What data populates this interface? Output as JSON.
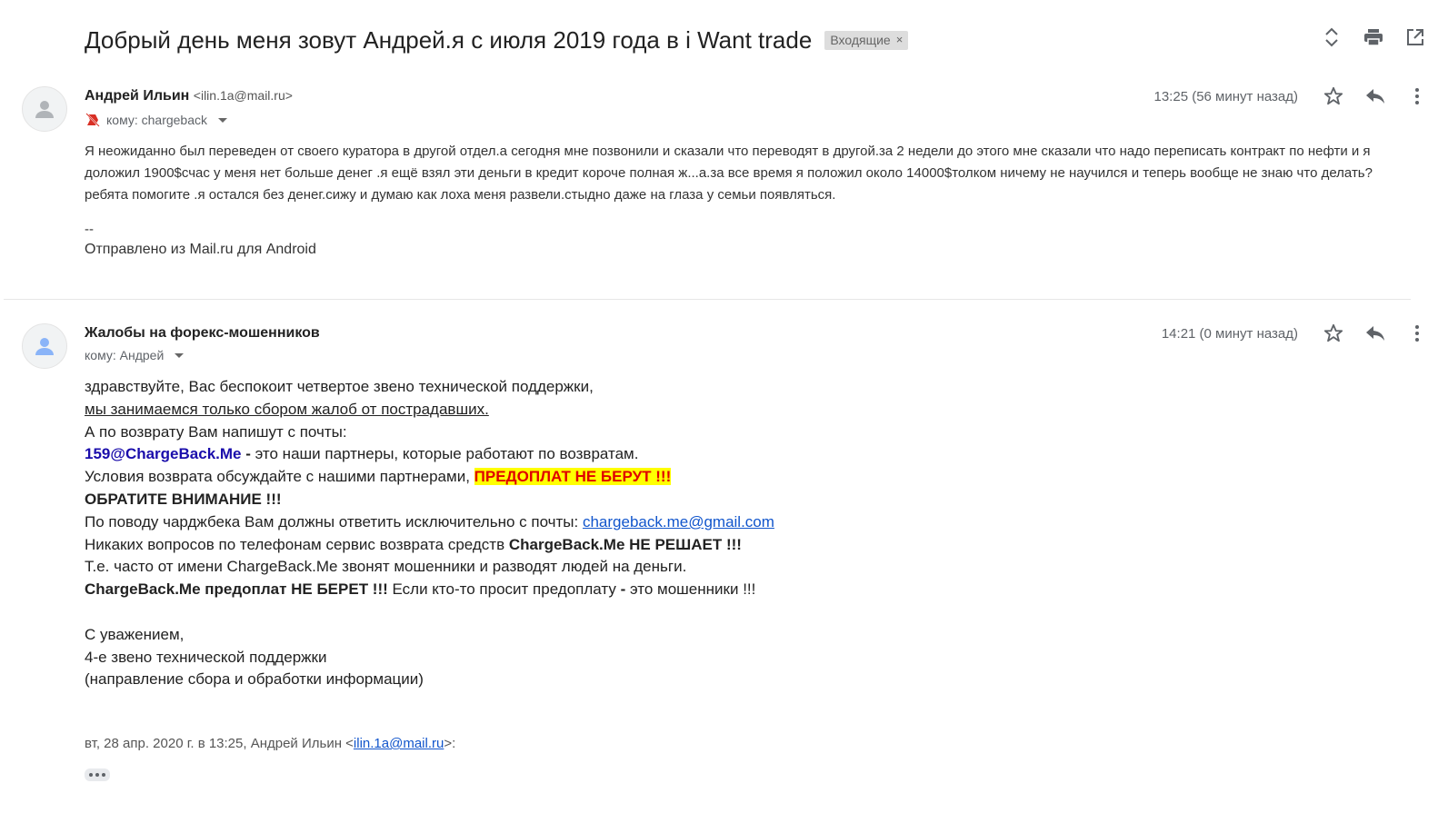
{
  "thread": {
    "subject": "Добрый день меня зовут Андрей.я с июля 2019 года в i Want trade",
    "label": "Входящие",
    "label_remove": "×",
    "icons": [
      "expand-collapse-icon",
      "print-icon",
      "open-in-new-window-icon"
    ]
  },
  "message1": {
    "sender_name": "Андрей Ильин",
    "sender_email": "<ilin.1a@mail.ru>",
    "recipient": "кому: chargeback",
    "time": "13:25 (56 минут назад)",
    "body": "Я неожиданно был переведен от своего куратора в другой отдел.а сегодня мне позвонили и сказали что переводят в другой.за 2 недели до этого мне сказали что надо переписать контракт по нефти и я доложил 1900$счас у меня нет больше денег .я ещё взял эти деньги в кредит короче полная ж...а.за все время я положил около 14000$толком ничему не научился и теперь вообще не знаю что делать?ребята помогите .я остался без денег.сижу и думаю как лоха меня развели.стыдно даже на глаза у  семьи  появляться.",
    "sig_separator": "--",
    "signature": "Отправлено из Mail.ru для Android"
  },
  "message2": {
    "sender_name": "Жалобы на форекс-мошенников",
    "recipient": "кому: Андрей",
    "time": "14:21 (0 минут назад)",
    "line1": "здравствуйте, Вас беспокоит четвертое звено технической поддержки,",
    "line2": "мы занимаемся только сбором жалоб от пострадавших.",
    "line3": "А по возврату Вам напишут с почты:",
    "line4_email": "159@ChargeBack.Me",
    "line4_dash": " - ",
    "line4_rest": "это наши партнеры, которые работают по возвратам.",
    "line5_text": "Условия возврата обсуждайте с нашими партнерами, ",
    "line5_highlight": "ПРЕДОПЛАТ НЕ БЕРУТ !!!",
    "line6": "ОБРАТИТЕ ВНИМАНИЕ !!!",
    "line7_text": "По поводу чарджбека Вам должны ответить исключительно с почты: ",
    "line7_link": "chargeback.me@gmail.com",
    "line8_text": "Никаких вопросов по телефонам сервис возврата средств ",
    "line8_bold": "ChargeBack.Me НЕ РЕШАЕТ !!!",
    "line9": "Т.е. часто от имени ChargeBack.Me звонят мошенники и разводят людей на деньги.",
    "line10_bold": "ChargeBack.Me предоплат НЕ БЕРЕТ !!!",
    "line10_text": " Если кто-то просит предоплату ",
    "line10_dash": "-",
    "line10_end": " это мошенники !!!",
    "closing1": "С уважением,",
    "closing2": "4-е звено технической поддержки",
    "closing3": "(направление сбора и обработки информации)",
    "quote_prefix": "вт, 28 апр. 2020 г. в 13:25, Андрей Ильин <",
    "quote_link": "ilin.1a@mail.ru",
    "quote_suffix": ">:"
  },
  "colors": {
    "highlight_bg": "#ffff00",
    "highlight_text": "#e00000",
    "link": "#1155cc",
    "partner_email": "#1a0dab"
  }
}
